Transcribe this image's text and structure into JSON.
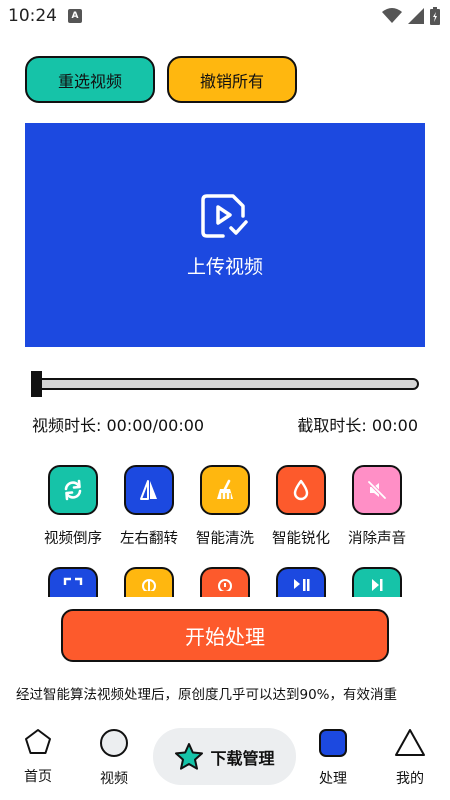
{
  "status": {
    "time": "10:24",
    "notification_badge": "A"
  },
  "actions": {
    "reselect_label": "重选视频",
    "undo_label": "撤销所有"
  },
  "upload": {
    "label": "上传视频"
  },
  "durations": {
    "video_duration": "视频时长: 00:00/00:00",
    "clip_duration": "截取时长: 00:00"
  },
  "tools": [
    {
      "label": "视频倒序",
      "icon": "refresh-icon",
      "color": "#16c3a8"
    },
    {
      "label": "左右翻转",
      "icon": "flip-icon",
      "color": "#1c49e0"
    },
    {
      "label": "智能清洗",
      "icon": "broom-icon",
      "color": "#ffb70f"
    },
    {
      "label": "智能锐化",
      "icon": "droplet-icon",
      "color": "#fd5a2c"
    },
    {
      "label": "消除声音",
      "icon": "mute-icon",
      "color": "#ff8fc6"
    }
  ],
  "tools_row2_colors": [
    "#1c49e0",
    "#ffb70f",
    "#fd5a2c",
    "#1c49e0",
    "#16c3a8"
  ],
  "start_label": "开始处理",
  "description": "经过智能算法视频处理后，原创度几乎可以达到90%，有效消重",
  "nav": {
    "home": "首页",
    "video": "视频",
    "download": "下载管理",
    "process": "处理",
    "mine": "我的"
  },
  "colors": {
    "teal": "#16c3a8",
    "yellow": "#ffb70f",
    "blue": "#1c49e0",
    "orange": "#fd5a2c",
    "pink": "#ff8fc6"
  }
}
